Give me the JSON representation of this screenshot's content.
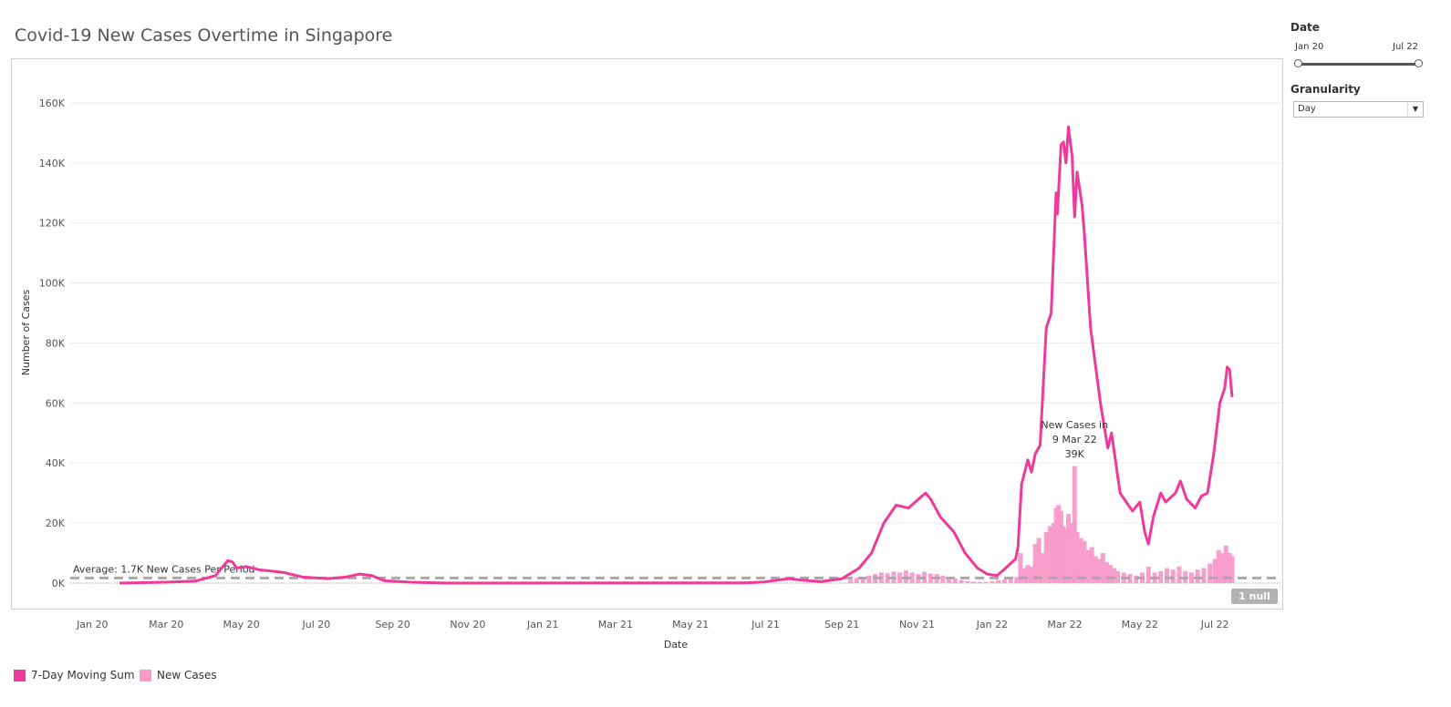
{
  "title": "Covid-19 New Cases Overtime in Singapore",
  "filters": {
    "date_label": "Date",
    "date_start": "Jan 20",
    "date_end": "Jul 22",
    "granularity_label": "Granularity",
    "granularity_value": "Day"
  },
  "legend": [
    {
      "label": "7-Day Moving Sum",
      "color": "#f0399a"
    },
    {
      "label": "New Cases",
      "color": "#f99ac9"
    }
  ],
  "null_badge": "1 null",
  "chart_data": {
    "type": "bar",
    "title": "Covid-19 New Cases Overtime in Singapore",
    "xlabel": "Date",
    "ylabel": "Number of Cases",
    "ylim": [
      0,
      170000
    ],
    "y_ticks": [
      0,
      20000,
      40000,
      60000,
      80000,
      100000,
      120000,
      140000,
      160000
    ],
    "y_tick_labels": [
      "0K",
      "20K",
      "40K",
      "60K",
      "80K",
      "100K",
      "120K",
      "140K",
      "160K"
    ],
    "x_range": [
      "2019-12-14",
      "2022-08-24"
    ],
    "x_ticks": [
      {
        "label": "Jan 20",
        "date": "2020-01-01"
      },
      {
        "label": "Mar 20",
        "date": "2020-03-01"
      },
      {
        "label": "May 20",
        "date": "2020-05-01"
      },
      {
        "label": "Jul 20",
        "date": "2020-07-01"
      },
      {
        "label": "Sep 20",
        "date": "2020-09-01"
      },
      {
        "label": "Nov 20",
        "date": "2020-11-01"
      },
      {
        "label": "Jan 21",
        "date": "2021-01-01"
      },
      {
        "label": "Mar 21",
        "date": "2021-03-01"
      },
      {
        "label": "May 21",
        "date": "2021-05-01"
      },
      {
        "label": "Jul 21",
        "date": "2021-07-01"
      },
      {
        "label": "Sep 21",
        "date": "2021-09-01"
      },
      {
        "label": "Nov 21",
        "date": "2021-11-01"
      },
      {
        "label": "Jan 22",
        "date": "2022-01-01"
      },
      {
        "label": "Mar 22",
        "date": "2022-03-01"
      },
      {
        "label": "May 22",
        "date": "2022-05-01"
      },
      {
        "label": "Jul 22",
        "date": "2022-07-01"
      }
    ],
    "average": {
      "value": 1700,
      "label": "Average: 1.7K New Cases Per Period"
    },
    "annotation": {
      "lines": [
        "New Cases in",
        "9 Mar 22",
        "39K"
      ],
      "date": "2022-03-09",
      "value": 39000
    },
    "series": [
      {
        "name": "7-Day Moving Sum",
        "kind": "line",
        "color": "#f0399a",
        "points": [
          [
            "2020-01-23",
            0
          ],
          [
            "2020-03-01",
            300
          ],
          [
            "2020-03-25",
            700
          ],
          [
            "2020-04-10",
            2500
          ],
          [
            "2020-04-20",
            7500
          ],
          [
            "2020-04-24",
            7000
          ],
          [
            "2020-04-27",
            5000
          ],
          [
            "2020-05-05",
            5500
          ],
          [
            "2020-05-15",
            4500
          ],
          [
            "2020-05-25",
            4000
          ],
          [
            "2020-06-05",
            3500
          ],
          [
            "2020-06-20",
            2000
          ],
          [
            "2020-07-10",
            1500
          ],
          [
            "2020-07-25",
            2000
          ],
          [
            "2020-08-05",
            3000
          ],
          [
            "2020-08-15",
            2500
          ],
          [
            "2020-08-25",
            800
          ],
          [
            "2020-09-15",
            300
          ],
          [
            "2020-10-15",
            0
          ],
          [
            "2021-06-15",
            100
          ],
          [
            "2021-06-30",
            400
          ],
          [
            "2021-07-15",
            1200
          ],
          [
            "2021-07-20",
            1500
          ],
          [
            "2021-07-30",
            1000
          ],
          [
            "2021-08-15",
            500
          ],
          [
            "2021-09-01",
            1500
          ],
          [
            "2021-09-15",
            5000
          ],
          [
            "2021-09-25",
            10000
          ],
          [
            "2021-10-05",
            20000
          ],
          [
            "2021-10-15",
            26000
          ],
          [
            "2021-10-25",
            25000
          ],
          [
            "2021-11-05",
            29000
          ],
          [
            "2021-11-08",
            30000
          ],
          [
            "2021-11-12",
            28000
          ],
          [
            "2021-11-20",
            22000
          ],
          [
            "2021-12-01",
            17000
          ],
          [
            "2021-12-10",
            10000
          ],
          [
            "2021-12-20",
            5000
          ],
          [
            "2021-12-28",
            3000
          ],
          [
            "2022-01-05",
            2500
          ],
          [
            "2022-01-12",
            5000
          ],
          [
            "2022-01-20",
            8000
          ],
          [
            "2022-01-22",
            12000
          ],
          [
            "2022-01-25",
            33000
          ],
          [
            "2022-01-30",
            41000
          ],
          [
            "2022-02-02",
            37000
          ],
          [
            "2022-02-05",
            43000
          ],
          [
            "2022-02-09",
            46000
          ],
          [
            "2022-02-14",
            85000
          ],
          [
            "2022-02-18",
            90000
          ],
          [
            "2022-02-22",
            130000
          ],
          [
            "2022-02-23",
            123000
          ],
          [
            "2022-02-26",
            146000
          ],
          [
            "2022-02-28",
            147000
          ],
          [
            "2022-03-02",
            140000
          ],
          [
            "2022-03-04",
            152000
          ],
          [
            "2022-03-07",
            142000
          ],
          [
            "2022-03-09",
            122000
          ],
          [
            "2022-03-11",
            137000
          ],
          [
            "2022-03-15",
            126000
          ],
          [
            "2022-03-17",
            116000
          ],
          [
            "2022-03-22",
            85000
          ],
          [
            "2022-03-30",
            60000
          ],
          [
            "2022-04-05",
            45000
          ],
          [
            "2022-04-08",
            50000
          ],
          [
            "2022-04-15",
            30000
          ],
          [
            "2022-04-20",
            27000
          ],
          [
            "2022-04-25",
            24000
          ],
          [
            "2022-05-01",
            27000
          ],
          [
            "2022-05-05",
            17000
          ],
          [
            "2022-05-08",
            13000
          ],
          [
            "2022-05-12",
            22000
          ],
          [
            "2022-05-18",
            30000
          ],
          [
            "2022-05-22",
            27000
          ],
          [
            "2022-05-30",
            30000
          ],
          [
            "2022-06-03",
            34000
          ],
          [
            "2022-06-08",
            28000
          ],
          [
            "2022-06-15",
            25000
          ],
          [
            "2022-06-20",
            29000
          ],
          [
            "2022-06-25",
            30000
          ],
          [
            "2022-06-30",
            43000
          ],
          [
            "2022-07-05",
            60000
          ],
          [
            "2022-07-09",
            65000
          ],
          [
            "2022-07-11",
            72000
          ],
          [
            "2022-07-13",
            71000
          ],
          [
            "2022-07-15",
            62000
          ]
        ]
      },
      {
        "name": "New Cases",
        "kind": "bar",
        "color": "#f99ac9",
        "points": [
          [
            "2021-09-08",
            1200
          ],
          [
            "2021-09-13",
            1800
          ],
          [
            "2021-09-18",
            2000
          ],
          [
            "2021-09-23",
            2500
          ],
          [
            "2021-09-28",
            3000
          ],
          [
            "2021-10-03",
            3500
          ],
          [
            "2021-10-08",
            3300
          ],
          [
            "2021-10-13",
            3800
          ],
          [
            "2021-10-18",
            3500
          ],
          [
            "2021-10-23",
            4200
          ],
          [
            "2021-10-28",
            3500
          ],
          [
            "2021-11-02",
            3000
          ],
          [
            "2021-11-07",
            3800
          ],
          [
            "2021-11-12",
            3200
          ],
          [
            "2021-11-17",
            3000
          ],
          [
            "2021-11-22",
            2500
          ],
          [
            "2021-11-27",
            2000
          ],
          [
            "2021-12-02",
            1500
          ],
          [
            "2021-12-07",
            1000
          ],
          [
            "2021-12-12",
            700
          ],
          [
            "2021-12-17",
            500
          ],
          [
            "2021-12-22",
            400
          ],
          [
            "2021-12-27",
            400
          ],
          [
            "2022-01-01",
            700
          ],
          [
            "2022-01-06",
            1000
          ],
          [
            "2022-01-11",
            1200
          ],
          [
            "2022-01-16",
            1800
          ],
          [
            "2022-01-21",
            2000
          ],
          [
            "2022-01-24",
            10000
          ],
          [
            "2022-01-27",
            5000
          ],
          [
            "2022-01-30",
            6000
          ],
          [
            "2022-02-02",
            5500
          ],
          [
            "2022-02-05",
            13000
          ],
          [
            "2022-02-08",
            15000
          ],
          [
            "2022-02-11",
            10000
          ],
          [
            "2022-02-14",
            17000
          ],
          [
            "2022-02-17",
            19000
          ],
          [
            "2022-02-20",
            20000
          ],
          [
            "2022-02-22",
            25000
          ],
          [
            "2022-02-24",
            26000
          ],
          [
            "2022-02-26",
            24000
          ],
          [
            "2022-02-28",
            19000
          ],
          [
            "2022-03-02",
            18000
          ],
          [
            "2022-03-04",
            23000
          ],
          [
            "2022-03-07",
            20000
          ],
          [
            "2022-03-09",
            39000
          ],
          [
            "2022-03-11",
            17000
          ],
          [
            "2022-03-14",
            15000
          ],
          [
            "2022-03-17",
            14000
          ],
          [
            "2022-03-20",
            11000
          ],
          [
            "2022-03-23",
            12000
          ],
          [
            "2022-03-26",
            9000
          ],
          [
            "2022-03-29",
            8000
          ],
          [
            "2022-04-01",
            10000
          ],
          [
            "2022-04-04",
            7000
          ],
          [
            "2022-04-07",
            6000
          ],
          [
            "2022-04-10",
            5000
          ],
          [
            "2022-04-13",
            4000
          ],
          [
            "2022-04-18",
            3500
          ],
          [
            "2022-04-23",
            3000
          ],
          [
            "2022-04-28",
            2500
          ],
          [
            "2022-05-03",
            3500
          ],
          [
            "2022-05-08",
            5500
          ],
          [
            "2022-05-13",
            3500
          ],
          [
            "2022-05-18",
            4000
          ],
          [
            "2022-05-23",
            5000
          ],
          [
            "2022-05-28",
            4500
          ],
          [
            "2022-06-02",
            5500
          ],
          [
            "2022-06-07",
            4000
          ],
          [
            "2022-06-12",
            3500
          ],
          [
            "2022-06-17",
            4500
          ],
          [
            "2022-06-22",
            5000
          ],
          [
            "2022-06-27",
            6500
          ],
          [
            "2022-07-01",
            8000
          ],
          [
            "2022-07-04",
            11000
          ],
          [
            "2022-07-07",
            10000
          ],
          [
            "2022-07-10",
            12500
          ],
          [
            "2022-07-13",
            10000
          ],
          [
            "2022-07-15",
            9000
          ]
        ]
      }
    ]
  }
}
